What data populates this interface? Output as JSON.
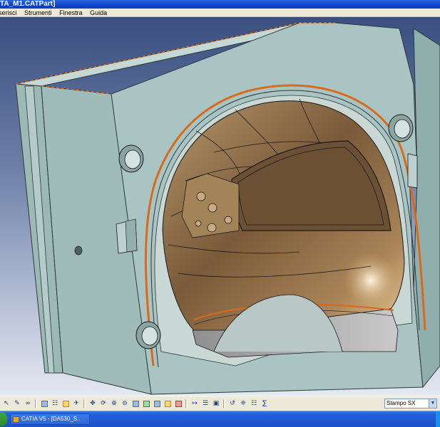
{
  "window": {
    "title": "TA_M1.CATPart]"
  },
  "menu": {
    "items": [
      "serisci",
      "Strumenti",
      "Finestra",
      "Guida"
    ]
  },
  "toolbar": {
    "icons": [
      "select-icon",
      "sketch-icon",
      "wireframe-icon",
      "grid-icon",
      "tree-icon",
      "formula-icon",
      "fly-icon",
      "pan-icon",
      "rotate-icon",
      "zoom-in-icon",
      "zoom-out-icon",
      "normal-view-icon",
      "iso-view-icon",
      "shading-icon",
      "hide-show-icon",
      "swap-icon",
      "measure-icon",
      "analysis-icon",
      "camera-icon",
      "publish-icon",
      "knowledge-icon",
      "catalog-icon",
      "parameters-icon"
    ],
    "combo_value": "Stampo SX"
  },
  "taskbar": {
    "buttons": [
      {
        "label": "CATIA V5 - [DA530_S...",
        "icon": "catia-icon"
      },
      {
        "label": "",
        "icon": "window-icon"
      }
    ]
  },
  "colors": {
    "titlebar": "#0a46cf",
    "mold_face": "#a9c4c2",
    "helmet": "#8a6a48",
    "cut_edge": "#d86a1c",
    "taskbar": "#245edc"
  }
}
